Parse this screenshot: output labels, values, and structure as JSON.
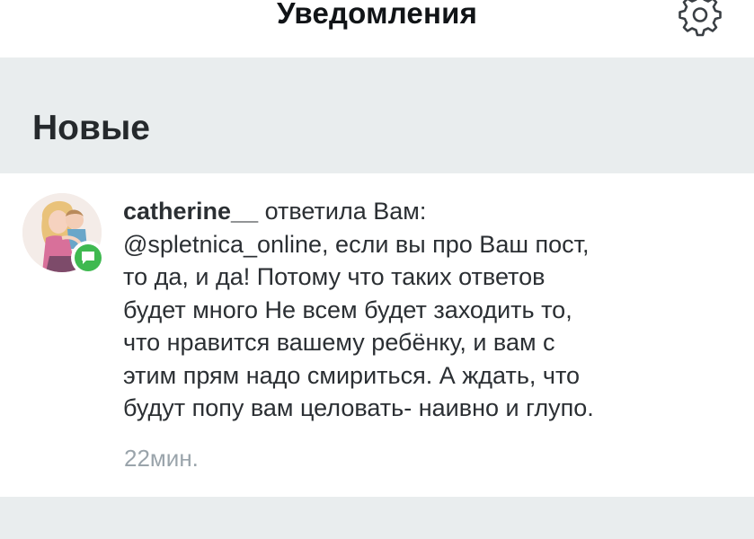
{
  "header": {
    "title": "Уведомления",
    "settings_icon": "gear-icon"
  },
  "section": {
    "label": "Новые"
  },
  "notification": {
    "username": "catherine__",
    "action": " ответила Вам:",
    "lines": [
      "@spletnica_online, если вы про Ваш пост,",
      "то да, и да! Потому что таких ответов",
      "будет много  Не всем будет заходить то,",
      "что нравится вашему ребёнку, и вам с",
      "этим прям надо смириться.  А ждать, что",
      "будут попу вам целовать- наивно и глупо."
    ],
    "time": "22мин.",
    "badge_icon": "comment-icon",
    "badge_color": "#3fb950"
  }
}
